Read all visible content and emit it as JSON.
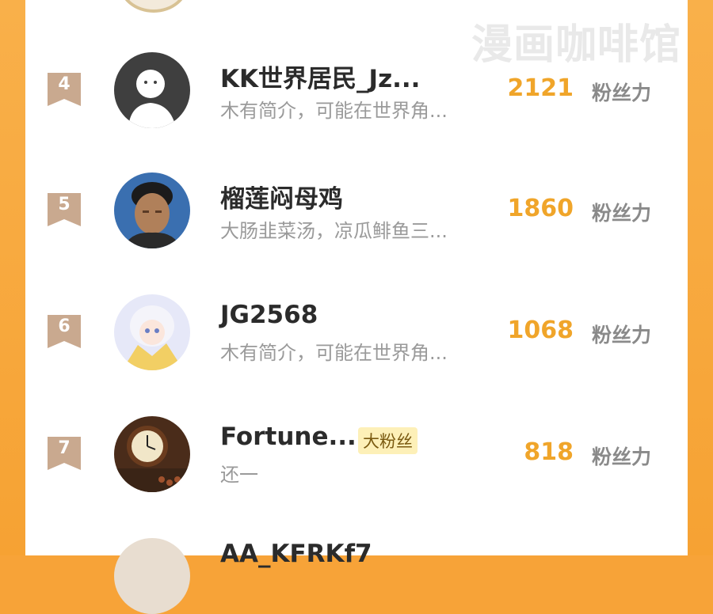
{
  "watermark": "漫画咖啡馆",
  "score_unit": "粉丝力",
  "rows": [
    {
      "rank": "4",
      "name": "KK世界居民_Jz...",
      "bio": "木有简介，可能在世界角...",
      "score": "2121",
      "avatar": "silhouette-avatar"
    },
    {
      "rank": "5",
      "name": "榴莲闷母鸡",
      "bio": "大肠韭菜汤，凉瓜鲱鱼三...",
      "score": "1860",
      "avatar": "man-photo-avatar"
    },
    {
      "rank": "6",
      "name": "JG2568",
      "bio": "木有简介，可能在世界角...",
      "score": "1068",
      "avatar": "anime-girl-avatar"
    },
    {
      "rank": "7",
      "name": "Fortune...",
      "badge": "大粉丝",
      "bio": "还一",
      "score": "818",
      "avatar": "clock-photo-avatar"
    }
  ],
  "partial_row": {
    "name": "AA_KFRKf7"
  },
  "colors": {
    "accent": "#f0a52a",
    "rank_badge": "#c9a98f",
    "frame": "#f7a338"
  }
}
